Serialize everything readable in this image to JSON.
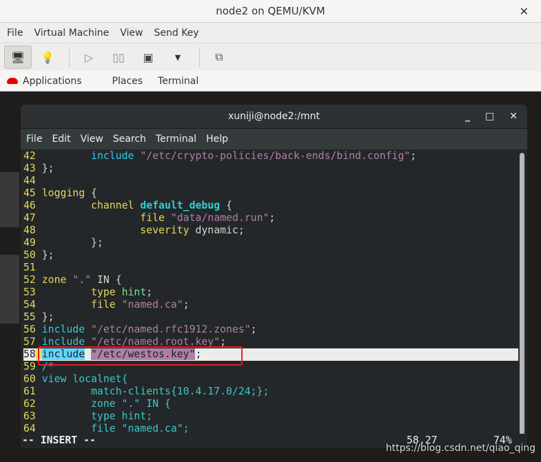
{
  "window": {
    "title": "node2 on QEMU/KVM",
    "close": "✕"
  },
  "menu": [
    "File",
    "Virtual Machine",
    "View",
    "Send Key"
  ],
  "toolbar": {
    "icons": [
      "monitor-icon",
      "lightbulb-icon",
      "play-icon",
      "pause-icon",
      "power-icon",
      "dropdown-icon",
      "screens-icon"
    ]
  },
  "gnome": {
    "items": [
      "Applications",
      "Places",
      "Terminal"
    ]
  },
  "terminal": {
    "title": "xuniji@node2:/mnt",
    "menu": [
      "File",
      "Edit",
      "View",
      "Search",
      "Terminal",
      "Help"
    ],
    "colors": {
      "y": "#e9d85a",
      "c": "#34c8e6",
      "s": "#b07fa8",
      "w": "#d3d7cf",
      "g": "#7ee08f",
      "b": "#2ed0d6",
      "m": "#3cc8c8"
    },
    "lines": [
      {
        "n": "42",
        "seg": [
          [
            "w",
            "        "
          ],
          [
            "c",
            "include"
          ],
          [
            "w",
            " "
          ],
          [
            "s",
            "\"/etc/crypto-policies/back-ends/bind.config\""
          ],
          [
            "w",
            ";"
          ]
        ]
      },
      {
        "n": "43",
        "seg": [
          [
            "w",
            "};"
          ]
        ]
      },
      {
        "n": "44",
        "seg": []
      },
      {
        "n": "45",
        "seg": [
          [
            "y",
            "logging"
          ],
          [
            "w",
            " {"
          ]
        ]
      },
      {
        "n": "46",
        "seg": [
          [
            "w",
            "        "
          ],
          [
            "y",
            "channel"
          ],
          [
            "w",
            " "
          ],
          [
            "b",
            "default_debug"
          ],
          [
            "w",
            " {"
          ]
        ]
      },
      {
        "n": "47",
        "seg": [
          [
            "w",
            "                "
          ],
          [
            "y",
            "file"
          ],
          [
            "w",
            " "
          ],
          [
            "s",
            "\"data/named.run\""
          ],
          [
            "w",
            ";"
          ]
        ]
      },
      {
        "n": "48",
        "seg": [
          [
            "w",
            "                "
          ],
          [
            "y",
            "severity"
          ],
          [
            "w",
            " dynamic;"
          ]
        ]
      },
      {
        "n": "49",
        "seg": [
          [
            "w",
            "        };"
          ]
        ]
      },
      {
        "n": "50",
        "seg": [
          [
            "w",
            "};"
          ]
        ]
      },
      {
        "n": "51",
        "seg": []
      },
      {
        "n": "52",
        "seg": [
          [
            "y",
            "zone"
          ],
          [
            "w",
            " "
          ],
          [
            "s",
            "\""
          ],
          [
            "c",
            "."
          ],
          [
            "s",
            "\""
          ],
          [
            "w",
            " IN {"
          ]
        ]
      },
      {
        "n": "53",
        "seg": [
          [
            "w",
            "        "
          ],
          [
            "y",
            "type"
          ],
          [
            "w",
            " "
          ],
          [
            "g",
            "hint"
          ],
          [
            "w",
            ";"
          ]
        ]
      },
      {
        "n": "54",
        "seg": [
          [
            "w",
            "        "
          ],
          [
            "y",
            "file"
          ],
          [
            "w",
            " "
          ],
          [
            "s",
            "\"named.ca\""
          ],
          [
            "w",
            ";"
          ]
        ]
      },
      {
        "n": "55",
        "seg": [
          [
            "w",
            "};"
          ]
        ]
      },
      {
        "n": "56",
        "seg": [
          [
            "c",
            "include"
          ],
          [
            "w",
            " "
          ],
          [
            "s",
            "\"/etc/named.rfc1912.zones\""
          ],
          [
            "w",
            ";"
          ]
        ]
      },
      {
        "n": "57",
        "seg": [
          [
            "c",
            "include"
          ],
          [
            "w",
            " "
          ],
          [
            "s",
            "\"/etc/named.root.key\""
          ],
          [
            "w",
            ";"
          ]
        ]
      },
      {
        "n": "58",
        "cur": true,
        "seg": [
          [
            "hc",
            "include"
          ],
          [
            "w",
            " "
          ],
          [
            "hs",
            "\"/etc/westos.key\""
          ],
          [
            "w",
            ";"
          ]
        ]
      },
      {
        "n": "59",
        "seg": [
          [
            "m",
            "/*"
          ]
        ]
      },
      {
        "n": "60",
        "seg": [
          [
            "m",
            "view localnet{"
          ]
        ]
      },
      {
        "n": "61",
        "seg": [
          [
            "m",
            "        match-clients{10.4.17.0/24;};"
          ]
        ]
      },
      {
        "n": "62",
        "seg": [
          [
            "m",
            "        zone \".\" IN {"
          ]
        ]
      },
      {
        "n": "63",
        "seg": [
          [
            "m",
            "        type hint;"
          ]
        ]
      },
      {
        "n": "64",
        "seg": [
          [
            "m",
            "        file \"named.ca\";"
          ]
        ]
      }
    ],
    "mode": "-- INSERT --",
    "position": "58,27",
    "percent": "74%"
  },
  "watermark": "https://blog.csdn.net/qiao_qing"
}
